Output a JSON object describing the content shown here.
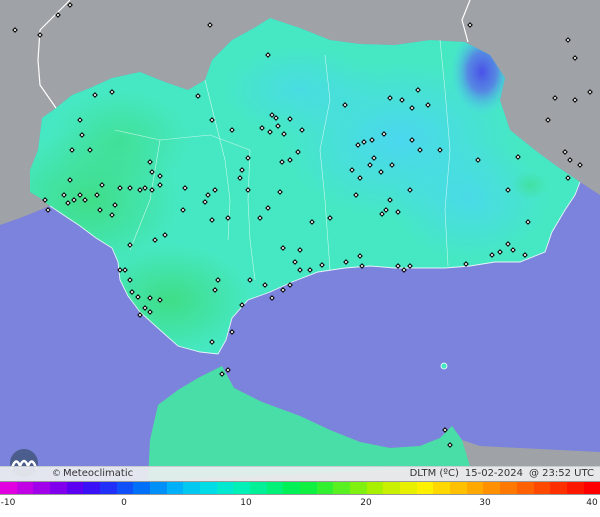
{
  "map": {
    "colors": {
      "sea": "#7b83dc",
      "neighbor_land": "#9fa2a6",
      "land_base": "#46e8c3",
      "land_warm": "#43e08e",
      "land_cold": "#49d8f0",
      "cold_spot": "#5060e6",
      "border": "#ffffff",
      "station_marker": "#000000"
    },
    "station_marker_symbol": "diamond"
  },
  "footer": {
    "brand": "Meteoclimatic",
    "copyright_symbol": "©",
    "variable": "DLTM (ºC)",
    "date": "15-02-2024",
    "time": "@ 23:52 UTC"
  },
  "scale": {
    "ticks": [
      "-10",
      "0",
      "10",
      "20",
      "30",
      "40"
    ],
    "range": [
      -10,
      40
    ],
    "colors": [
      "#e000e0",
      "#c200e6",
      "#a000ea",
      "#8000ee",
      "#5c00f2",
      "#3a10f6",
      "#2030f8",
      "#1050f8",
      "#0070f8",
      "#0090f8",
      "#00b0f8",
      "#00c8f0",
      "#00dce6",
      "#00e8d0",
      "#00f0b8",
      "#00f098",
      "#00f078",
      "#00f058",
      "#10f040",
      "#30f030",
      "#58f020",
      "#80f010",
      "#a8f000",
      "#c8f000",
      "#e8f000",
      "#fff000",
      "#ffd800",
      "#ffc000",
      "#ffa800",
      "#ff9000",
      "#ff7800",
      "#ff6000",
      "#ff4800",
      "#ff3000",
      "#ff1800",
      "#ff0000"
    ]
  }
}
